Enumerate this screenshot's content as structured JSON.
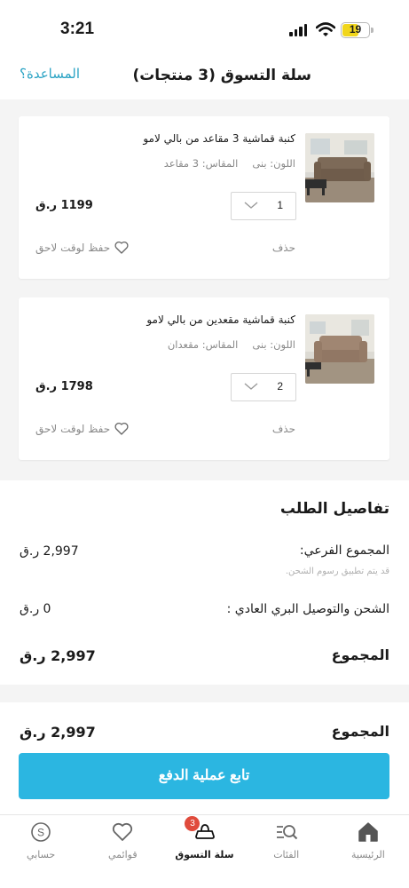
{
  "status_bar": {
    "time": "3:21",
    "battery": "19"
  },
  "header": {
    "title": "سلة التسوق (3 منتجات)",
    "help_link": "المساعدة؟"
  },
  "cart": {
    "items": [
      {
        "name": "كنبة قماشية 3 مقاعد من بالي لامو",
        "color": "اللون: بنى",
        "size": "المقاس: 3 مقاعد",
        "quantity": "1",
        "price": "1199 ر.ق",
        "delete_label": "حذف",
        "save_later_label": "حفظ لوقت لاحق",
        "thumbnail_icon": "sofa-3-seater-icon"
      },
      {
        "name": "كنبة قماشية مقعدين من بالي لامو",
        "color": "اللون: بنى",
        "size": "المقاس: مقعدان",
        "quantity": "2",
        "price": "1798 ر.ق",
        "delete_label": "حذف",
        "save_later_label": "حفظ لوقت لاحق",
        "thumbnail_icon": "sofa-2-seater-icon"
      }
    ]
  },
  "order_details": {
    "title": "تفاصيل الطلب",
    "subtotal_label": "المجموع الفرعي:",
    "subtotal_value": "2,997 ر.ق",
    "shipping_note": "قد يتم تطبيق رسوم الشحن.",
    "shipping_label": "الشحن والتوصيل البري العادي :",
    "shipping_value": "0 ر.ق",
    "total_label": "المجموع",
    "total_value": "2,997 ر.ق"
  },
  "checkout": {
    "total_label": "المجموع",
    "total_value": "2,997 ر.ق",
    "button_label": "تابع عملية الدفع",
    "button_color": "#2bb6e1"
  },
  "bottom_nav": {
    "items": [
      {
        "label": "الرئيسية",
        "icon": "home-icon"
      },
      {
        "label": "الفئات",
        "icon": "categories-search-icon"
      },
      {
        "label": "سلة التسوق",
        "icon": "cart-icon",
        "badge": "3",
        "active": true
      },
      {
        "label": "قوائمي",
        "icon": "heart-icon"
      },
      {
        "label": "حسابي",
        "icon": "account-coin-icon"
      }
    ]
  },
  "colors": {
    "accent": "#2aa3c4",
    "badge": "#e04b3c",
    "background_gray": "#f4f4f4"
  }
}
